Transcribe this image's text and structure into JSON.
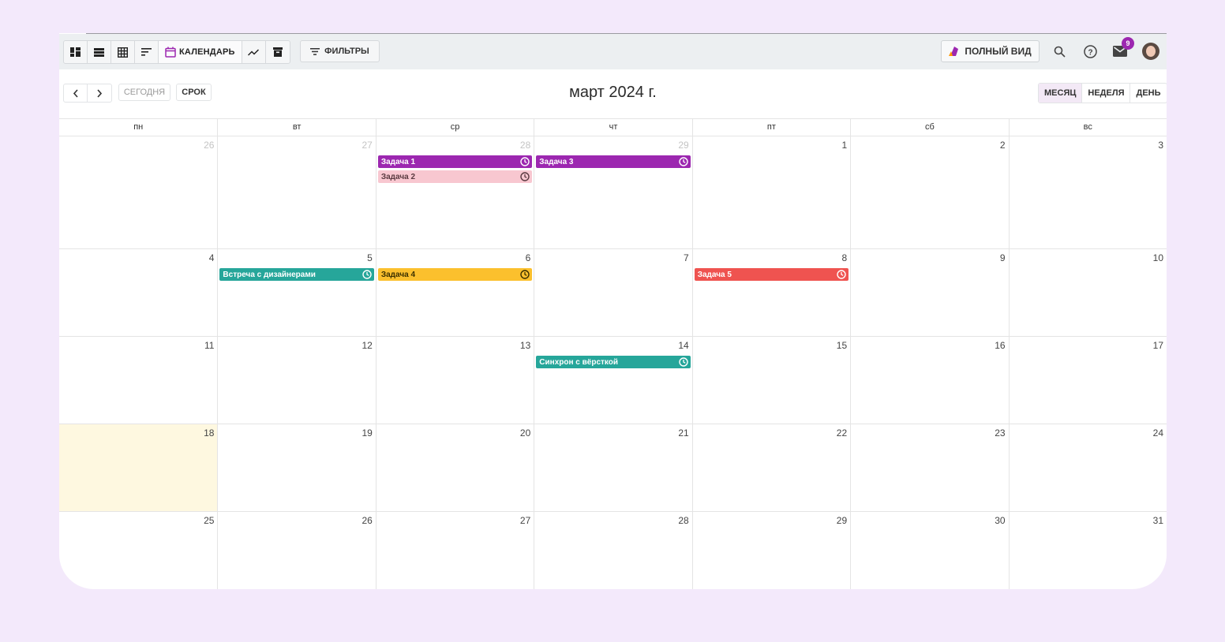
{
  "toolbar": {
    "views": [
      {
        "name": "board-view-icon"
      },
      {
        "name": "list-view-icon"
      },
      {
        "name": "table-view-icon"
      },
      {
        "name": "sort-view-icon"
      },
      {
        "name": "calendar-view-icon",
        "label": "КАЛЕНДАРЬ",
        "active": true
      },
      {
        "name": "chart-view-icon"
      },
      {
        "name": "archive-view-icon"
      }
    ],
    "filters_label": "ФИЛЬТРЫ",
    "full_view_label": "ПОЛНЫЙ ВИД",
    "notification_count": "9",
    "accent": "#9c27b0"
  },
  "calendar": {
    "today_label": "СЕГОДНЯ",
    "deadline_label": "СРОК",
    "title": "март 2024 г.",
    "view_modes": [
      "МЕСЯЦ",
      "НЕДЕЛЯ",
      "ДЕНЬ"
    ],
    "active_view": "МЕСЯЦ",
    "weekdays": [
      "пн",
      "вт",
      "ср",
      "чт",
      "пт",
      "сб",
      "вс"
    ],
    "weeks": [
      {
        "days": [
          "26",
          "27",
          "28",
          "29",
          "1",
          "2",
          "3"
        ],
        "muted": [
          true,
          true,
          true,
          true,
          false,
          false,
          false
        ]
      },
      {
        "days": [
          "4",
          "5",
          "6",
          "7",
          "8",
          "9",
          "10"
        ],
        "muted": [
          false,
          false,
          false,
          false,
          false,
          false,
          false
        ]
      },
      {
        "days": [
          "11",
          "12",
          "13",
          "14",
          "15",
          "16",
          "17"
        ],
        "muted": [
          false,
          false,
          false,
          false,
          false,
          false,
          false
        ]
      },
      {
        "days": [
          "18",
          "19",
          "20",
          "21",
          "22",
          "23",
          "24"
        ],
        "muted": [
          false,
          false,
          false,
          false,
          false,
          false,
          false
        ]
      },
      {
        "days": [
          "25",
          "26",
          "27",
          "28",
          "29",
          "30",
          "31"
        ],
        "muted": [
          false,
          false,
          false,
          false,
          false,
          false,
          false
        ]
      }
    ],
    "today": {
      "week": 3,
      "day": 0
    },
    "events": [
      {
        "title": "Задача 1",
        "week": 0,
        "day": 2,
        "row": 0,
        "bg": "#9c27b0",
        "fg": "#ffffff"
      },
      {
        "title": "Задача 2",
        "week": 0,
        "day": 2,
        "row": 1,
        "bg": "#f8c7d0",
        "fg": "#5a3a40"
      },
      {
        "title": "Задача 3",
        "week": 0,
        "day": 3,
        "row": 0,
        "bg": "#9c27b0",
        "fg": "#ffffff"
      },
      {
        "title": "Встреча с дизайнерами",
        "week": 1,
        "day": 1,
        "row": 0,
        "bg": "#26a69a",
        "fg": "#ffffff"
      },
      {
        "title": "Задача 4",
        "week": 1,
        "day": 2,
        "row": 0,
        "bg": "#fbc02d",
        "fg": "#3a3000"
      },
      {
        "title": "Задача 5",
        "week": 1,
        "day": 4,
        "row": 0,
        "bg": "#ef5350",
        "fg": "#ffffff"
      },
      {
        "title": "Синхрон с вёрсткой",
        "week": 2,
        "day": 3,
        "row": 0,
        "bg": "#26a69a",
        "fg": "#ffffff"
      }
    ]
  }
}
